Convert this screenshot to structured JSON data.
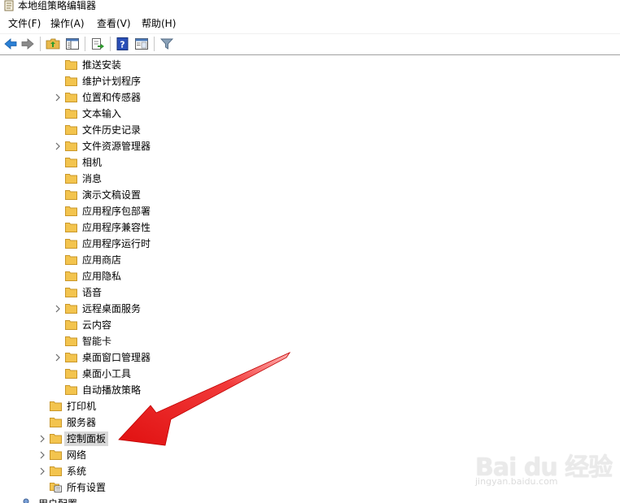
{
  "window": {
    "title": "本地组策略编辑器"
  },
  "menu": [
    {
      "label": "文件(F)"
    },
    {
      "label": "操作(A)"
    },
    {
      "label": "查看(V)"
    },
    {
      "label": "帮助(H)"
    }
  ],
  "toolbar": [
    {
      "name": "back-icon"
    },
    {
      "name": "forward-icon"
    },
    {
      "name": "up-folder-icon"
    },
    {
      "name": "show-hide-tree-icon"
    },
    {
      "name": "export-list-icon"
    },
    {
      "name": "help-icon"
    },
    {
      "name": "properties-icon"
    },
    {
      "name": "filter-icon"
    }
  ],
  "tree": {
    "children_level": [
      {
        "label": "推送安装",
        "expandable": false
      },
      {
        "label": "维护计划程序",
        "expandable": false
      },
      {
        "label": "位置和传感器",
        "expandable": true
      },
      {
        "label": "文本输入",
        "expandable": false
      },
      {
        "label": "文件历史记录",
        "expandable": false
      },
      {
        "label": "文件资源管理器",
        "expandable": true
      },
      {
        "label": "相机",
        "expandable": false
      },
      {
        "label": "消息",
        "expandable": false
      },
      {
        "label": "演示文稿设置",
        "expandable": false
      },
      {
        "label": "应用程序包部署",
        "expandable": false
      },
      {
        "label": "应用程序兼容性",
        "expandable": false
      },
      {
        "label": "应用程序运行时",
        "expandable": false
      },
      {
        "label": "应用商店",
        "expandable": false
      },
      {
        "label": "应用隐私",
        "expandable": false
      },
      {
        "label": "语音",
        "expandable": false
      },
      {
        "label": "远程桌面服务",
        "expandable": true
      },
      {
        "label": "云内容",
        "expandable": false
      },
      {
        "label": "智能卡",
        "expandable": false
      },
      {
        "label": "桌面窗口管理器",
        "expandable": true
      },
      {
        "label": "桌面小工具",
        "expandable": false
      },
      {
        "label": "自动播放策略",
        "expandable": false
      }
    ],
    "parent_level": [
      {
        "label": "打印机",
        "expandable": false
      },
      {
        "label": "服务器",
        "expandable": false
      },
      {
        "label": "控制面板",
        "expandable": true,
        "selected": true
      },
      {
        "label": "网络",
        "expandable": true
      },
      {
        "label": "系统",
        "expandable": true
      },
      {
        "label": "所有设置",
        "expandable": false,
        "icon": "settings-list-icon"
      }
    ],
    "root_level": [
      {
        "label": "用户配置"
      }
    ]
  },
  "watermark": {
    "brand": "Bai du 经验",
    "url": "jingyan.baidu.com"
  },
  "colors": {
    "arrow": "#ee1111",
    "folder": "#f3c44e",
    "selection": "#d9d9d9"
  }
}
